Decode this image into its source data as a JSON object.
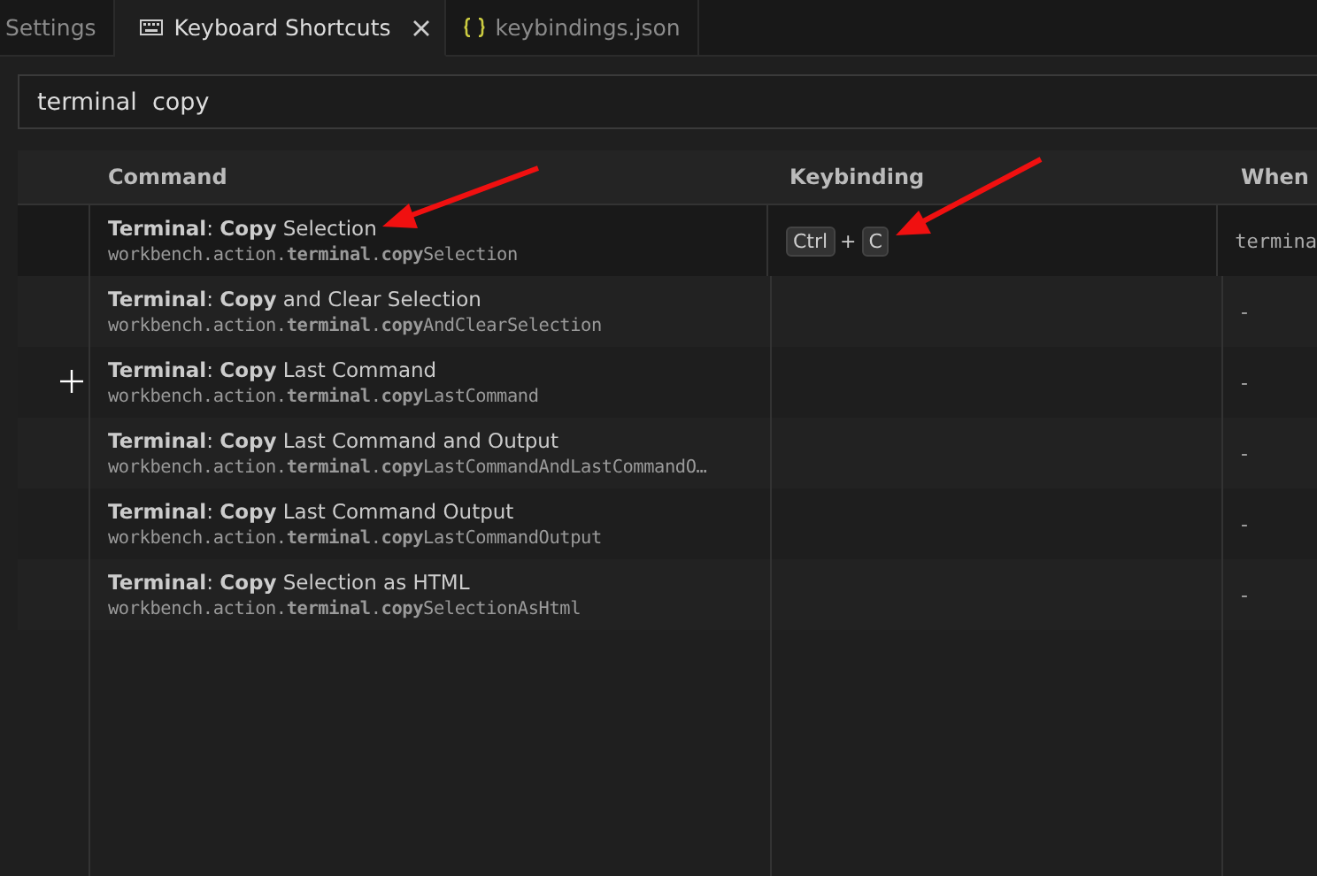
{
  "tabs": [
    {
      "label": "Settings",
      "kind": "settings",
      "selected": false,
      "closable": false
    },
    {
      "label": "Keyboard Shortcuts",
      "kind": "keyboard",
      "selected": true,
      "closable": true
    },
    {
      "label": "keybindings.json",
      "kind": "json",
      "selected": false,
      "closable": false
    }
  ],
  "search": {
    "value": "terminal  copy"
  },
  "table": {
    "columns": [
      "Command",
      "Keybinding",
      "When"
    ],
    "rows": [
      {
        "title": "**Terminal**: **Copy** Selection",
        "command_id": "workbench.action.**terminal**.**copy**Selection",
        "keybinding": [
          {
            "kind": "key",
            "text": "Ctrl"
          },
          {
            "kind": "sep",
            "text": "+"
          },
          {
            "kind": "key",
            "text": "C"
          }
        ],
        "when": "termina",
        "selected": true
      },
      {
        "title": "**Terminal**: **Copy** and Clear Selection",
        "command_id": "workbench.action.**terminal**.**copy**AndClearSelection",
        "keybinding": [],
        "when": "-",
        "selected": false
      },
      {
        "title": "**Terminal**: **Copy** Last Command",
        "command_id": "workbench.action.**terminal**.**copy**LastCommand",
        "keybinding": [],
        "when": "-",
        "selected": false
      },
      {
        "title": "**Terminal**: **Copy** Last Command and Output",
        "command_id": "workbench.action.**terminal**.**copy**LastCommandAndLastCommandO…",
        "keybinding": [],
        "when": "-",
        "selected": false
      },
      {
        "title": "**Terminal**: **Copy** Last Command Output",
        "command_id": "workbench.action.**terminal**.**copy**LastCommandOutput",
        "keybinding": [],
        "when": "-",
        "selected": false
      },
      {
        "title": "**Terminal**: **Copy** Selection as HTML",
        "command_id": "workbench.action.**terminal**.**copy**SelectionAsHtml",
        "keybinding": [],
        "when": "-",
        "selected": false
      }
    ]
  }
}
